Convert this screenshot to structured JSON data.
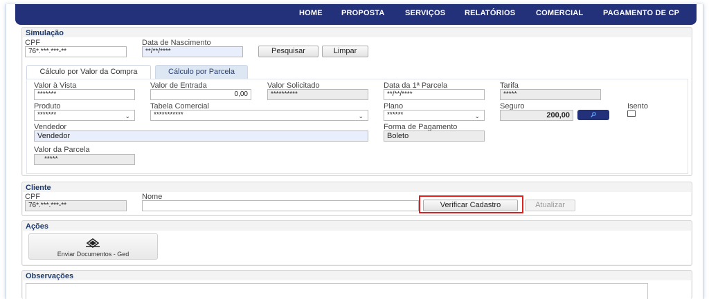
{
  "nav": {
    "items": [
      "HOME",
      "PROPOSTA",
      "SERVIÇOS",
      "RELATÓRIOS",
      "COMERCIAL",
      "PAGAMENTO DE CP"
    ]
  },
  "simulacao": {
    "title": "Simulação",
    "cpf_label": "CPF",
    "cpf_value": "76*.***.***-**",
    "nasc_label": "Data de Nascimento",
    "nasc_value": "**/**/****",
    "pesquisar_label": "Pesquisar",
    "limpar_label": "Limpar",
    "tabs": [
      {
        "label": "Cálculo por Valor da Compra",
        "active": true
      },
      {
        "label": "Cálculo por Parcela",
        "active": false
      }
    ],
    "valor_vista_label": "Valor à Vista",
    "valor_vista_value": "*******",
    "valor_entrada_label": "Valor de Entrada",
    "valor_entrada_value": "0,00",
    "valor_solicitado_label": "Valor Solicitado",
    "valor_solicitado_value": "**********",
    "data_parcela_label": "Data da 1ª Parcela",
    "data_parcela_value": "**/**/****",
    "tarifa_label": "Tarifa",
    "tarifa_value": "*****",
    "produto_label": "Produto",
    "produto_value": "*******",
    "tabela_label": "Tabela Comercial",
    "tabela_value": "***********",
    "plano_label": "Plano",
    "plano_value": "******",
    "seguro_label": "Seguro",
    "seguro_value": "200,00",
    "isento_label": "Isento",
    "vendedor_label": "Vendedor",
    "vendedor_value": "Vendedor",
    "forma_label": "Forma de Pagamento",
    "forma_value": "Boleto",
    "valor_parcela_label": "Valor da Parcela",
    "valor_parcela_value": "*****"
  },
  "cliente": {
    "title": "Cliente",
    "cpf_label": "CPF",
    "cpf_value": "76*.***.***-**",
    "nome_label": "Nome",
    "nome_value": "",
    "verificar_label": "Verificar Cadastro",
    "atualizar_label": "Atualizar"
  },
  "acoes": {
    "title": "Ações",
    "enviar_label": "Enviar Documentos - Ged"
  },
  "observacoes": {
    "title": "Observações"
  },
  "colors": {
    "nav_bg": "#23317a",
    "highlight": "#e02020"
  }
}
